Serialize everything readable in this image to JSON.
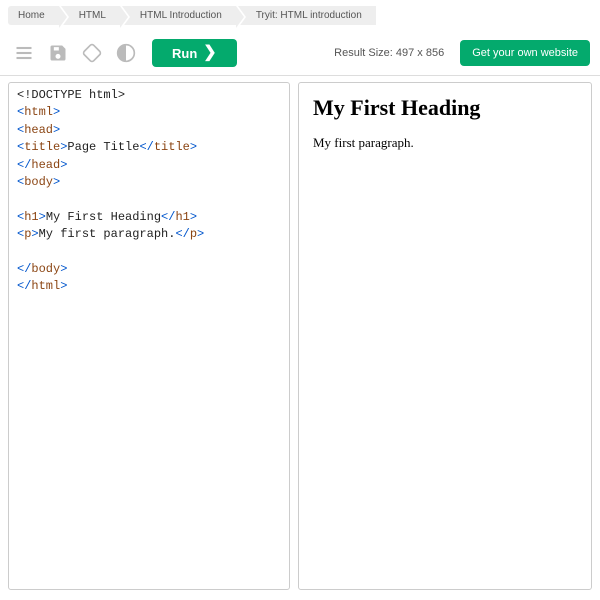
{
  "breadcrumb": [
    "Home",
    "HTML",
    "HTML Introduction",
    "Tryit: HTML introduction"
  ],
  "toolbar": {
    "run_label": "Run",
    "result_size_label": "Result Size: 497 x 856",
    "cta_label": "Get your own website"
  },
  "code": {
    "l1": "<!DOCTYPE html>",
    "l2o": "<",
    "l2t": "html",
    "l2c": ">",
    "l3o": "<",
    "l3t": "head",
    "l3c": ">",
    "l4o": "<",
    "l4t": "title",
    "l4c": ">",
    "l4txt": "Page Title",
    "l4o2": "</",
    "l4t2": "title",
    "l4c2": ">",
    "l5o": "</",
    "l5t": "head",
    "l5c": ">",
    "l6o": "<",
    "l6t": "body",
    "l6c": ">",
    "l8o": "<",
    "l8t": "h1",
    "l8c": ">",
    "l8txt": "My First Heading",
    "l8o2": "</",
    "l8t2": "h1",
    "l8c2": ">",
    "l9o": "<",
    "l9t": "p",
    "l9c": ">",
    "l9txt": "My first paragraph.",
    "l9o2": "</",
    "l9t2": "p",
    "l9c2": ">",
    "l11o": "</",
    "l11t": "body",
    "l11c": ">",
    "l12o": "</",
    "l12t": "html",
    "l12c": ">"
  },
  "preview": {
    "heading": "My First Heading",
    "paragraph": "My first paragraph."
  }
}
